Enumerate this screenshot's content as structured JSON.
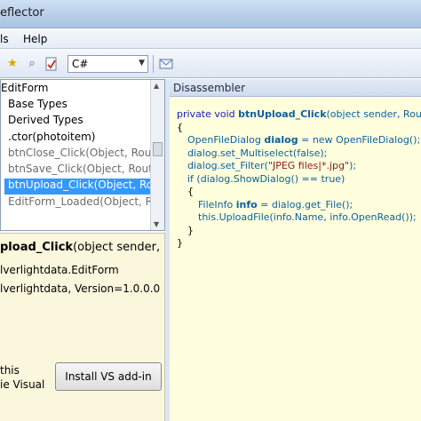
{
  "window": {
    "title": "eflector"
  },
  "menu": {
    "items": [
      "ls",
      "Help"
    ]
  },
  "toolbar": {
    "language": "C#"
  },
  "tree": {
    "items": [
      {
        "label": "EditForm",
        "state": "normal"
      },
      {
        "label": "Base Types",
        "state": "normal"
      },
      {
        "label": "Derived Types",
        "state": "normal"
      },
      {
        "label": ".ctor(photoitem)",
        "state": "normal"
      },
      {
        "label": "btnClose_Click(Object, Routed",
        "state": "dim"
      },
      {
        "label": "btnSave_Click(Object, RoutedE",
        "state": "dim"
      },
      {
        "label": "btnUpload_Click(Object, Rout",
        "state": "selected"
      },
      {
        "label": "EditForm_Loaded(Object, Rou",
        "state": "dim"
      }
    ]
  },
  "info": {
    "signature_name": "pload_Click",
    "signature_rest": "(object sender, R",
    "line1": "lverlightdata.EditForm",
    "line2": "lverlightdata, Version=1.0.0.0",
    "addin_text_1": "this",
    "addin_text_2": "ie Visual",
    "install_button": "Install VS add-in"
  },
  "disassembler": {
    "header": "Disassembler",
    "code": {
      "l1_kw": "private void ",
      "l1_name": "btnUpload_Click",
      "l1_rest": "(object sender, Routed",
      "l2": "{",
      "l3_type": "OpenFileDialog ",
      "l3_var": "dialog",
      "l3_rest": " = new OpenFileDialog();",
      "l4": "dialog.set_Multiselect(false);",
      "l5_pre": "dialog.set_Filter(",
      "l5_str": "\"JPEG files|*.jpg\"",
      "l5_post": ");",
      "l6": "if (dialog.ShowDialog() == true)",
      "l7": "{",
      "l8_type": "FileInfo ",
      "l8_var": "info",
      "l8_rest": " = dialog.get_File();",
      "l9": "this.UploadFile(info.Name, info.OpenRead());",
      "l10": "}",
      "l11": "}"
    }
  }
}
